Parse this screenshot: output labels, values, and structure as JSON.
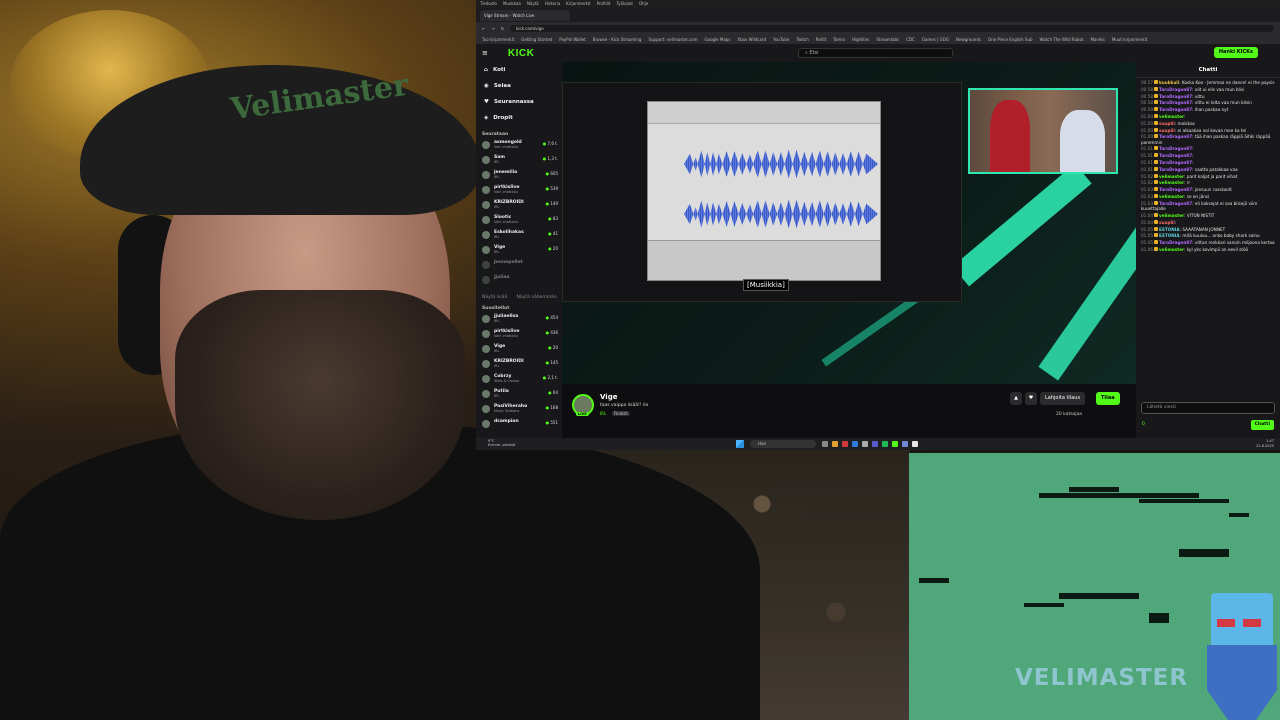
{
  "os_menu": [
    "Tiedosto",
    "Muokkaa",
    "Näytä",
    "Historia",
    "Kirjanmerkit",
    "Profiilit",
    "Työkalut",
    "Ohje"
  ],
  "browser": {
    "tab_title": "Vige Stream - Watch Live",
    "url": "kick.com/vige",
    "bookmarks": [
      "Tuo kirjanmerkit",
      "Getting Started",
      "PayPal Wallet",
      "Browse - Kick Streaming",
      "Support: velimaster.com",
      "Google Maps",
      "Xbox Wildcard",
      "YouTube",
      "Twitch",
      "Reitit",
      "Tomio",
      "Highlites",
      "Streamlabs",
      "CDC",
      "Games | GOG",
      "Newgrounds",
      "One Piece English Sub",
      "Watch The Wild Robot",
      "Mareks",
      "Muut kirjanmerkit"
    ]
  },
  "kick": {
    "logo": "KICK",
    "search_placeholder": "Etsi",
    "login_label": "Hanki KICKs",
    "nav": {
      "home": "Koti",
      "browse": "Selaa",
      "following": "Seurannassa",
      "drops": "Dropit"
    },
    "section_following": "Seurataan",
    "section_recommended": "Suositellut",
    "following_channels": [
      {
        "name": "asmongold",
        "sub": "Vain chattailu",
        "count": "7,6 t."
      },
      {
        "name": "Sam",
        "sub": "IRL",
        "count": "1,3 t."
      },
      {
        "name": "jenemilia",
        "sub": "IRL",
        "count": "605"
      },
      {
        "name": "pirtkislive",
        "sub": "Vain chattailu",
        "count": "539"
      },
      {
        "name": "KRIZBROIDI",
        "sub": "IRL",
        "count": "149"
      },
      {
        "name": "Slootic",
        "sub": "Vain chattailu",
        "count": "83"
      },
      {
        "name": "Eskolihakas",
        "sub": "IRL",
        "count": "41"
      },
      {
        "name": "Vige",
        "sub": "IRL",
        "count": "20"
      },
      {
        "name": "Jonnepellet",
        "sub": "",
        "count": ""
      },
      {
        "name": "jjuliaa",
        "sub": "",
        "count": ""
      }
    ],
    "show_more": "Näytä lisää",
    "show_less": "Näytä vähemmän",
    "recommended_channels": [
      {
        "name": "jjuliaelisa",
        "sub": "IRL",
        "count": "454"
      },
      {
        "name": "pirtkislive",
        "sub": "Vain chattailu",
        "count": "436"
      },
      {
        "name": "Vige",
        "sub": "IRL",
        "count": "20"
      },
      {
        "name": "KRIZBROIDI",
        "sub": "IRL",
        "count": "145"
      },
      {
        "name": "Cobrzy",
        "sub": "Slots & Casino",
        "count": "2,1 t."
      },
      {
        "name": "Putila",
        "sub": "IRL",
        "count": "64"
      },
      {
        "name": "PasiViheraho",
        "sub": "Music Stations",
        "count": "168"
      },
      {
        "name": "dcampion",
        "sub": "",
        "count": "551"
      }
    ],
    "subtitle": "[Musiikkia]",
    "streamer_name": "Vige",
    "stream_title": "taas vaippa lisää!! ilo",
    "category": "IRL",
    "tag": "Finnish",
    "gift_label": "Lahjoita tilaus",
    "follow_label": "Tilaa",
    "viewers": "20 katsojaa",
    "live_badge": "LIVE"
  },
  "chat": {
    "title": "Chatti",
    "messages": [
      {
        "time": "00.57",
        "user": "kuukkuli",
        "color": "#f0c040",
        "text": "Koska Koo - Jemmaa ne dance! ei the paysis"
      },
      {
        "time": "00.58",
        "user": "TaroDragon87",
        "color": "#b36bff",
        "text": "olit ui elis vaa mun blisi"
      },
      {
        "time": "00.58",
        "user": "TaroDragon87",
        "color": "#b36bff",
        "text": "vittu"
      },
      {
        "time": "00.58",
        "user": "TaroDragon87",
        "color": "#b36bff",
        "text": "vittu ei lolta vaa mun bilsin"
      },
      {
        "time": "00.59",
        "user": "TaroDragon87",
        "color": "#b36bff",
        "text": "ihan paskaa nyt"
      },
      {
        "time": "01.00",
        "user": "velimaster",
        "color": "#53fc18",
        "text": ""
      },
      {
        "time": "01.00",
        "user": "suuplii",
        "color": "#ff6b6b",
        "text": "moikkas"
      },
      {
        "time": "01.00",
        "user": "suuplii",
        "color": "#ff6b6b",
        "text": "ei alkaakaa noi kovaa mee ka tei"
      },
      {
        "time": "01.00",
        "user": "TaroDragon87",
        "color": "#b36bff",
        "text": "tää ihan paskaa räppiä äitiki räppää paremmin"
      },
      {
        "time": "01.01",
        "user": "TaroDragon87",
        "color": "#b36bff",
        "text": ""
      },
      {
        "time": "01.01",
        "user": "TaroDragon87",
        "color": "#b36bff",
        "text": ""
      },
      {
        "time": "01.01",
        "user": "TaroDragon87",
        "color": "#b36bff",
        "text": ""
      },
      {
        "time": "01.01",
        "user": "TaroDragon87",
        "color": "#b36bff",
        "text": "saatto patakkaa vaa"
      },
      {
        "time": "01.02",
        "user": "velimaster",
        "color": "#53fc18",
        "text": "parit kaljat ja parit vihat"
      },
      {
        "time": "01.02",
        "user": "velimaster",
        "color": "#53fc18",
        "text": "rr"
      },
      {
        "time": "01.03",
        "user": "TaroDragon87",
        "color": "#b36bff",
        "text": "jonsuun russkanit"
      },
      {
        "time": "01.03",
        "user": "velimaster",
        "color": "#53fc18",
        "text": "se on jänsi"
      },
      {
        "time": "01.03",
        "user": "TaroDragon87",
        "color": "#b36bff",
        "text": "eli kaksejat ei saa biisejä viim kuuettajalle"
      },
      {
        "time": "01.04",
        "user": "velimaster",
        "color": "#53fc18",
        "text": "VITUN NISTIT"
      },
      {
        "time": "01.04",
        "user": "suuplii",
        "color": "#ff6b6b",
        "text": ""
      },
      {
        "time": "01.05",
        "user": "ESTONIA",
        "color": "#5fd0e0",
        "text": "SAAATANAN JONNET"
      },
      {
        "time": "01.05",
        "user": "ESTONIA",
        "color": "#5fd0e0",
        "text": "mitä kuuluu... onko baby shark soinu"
      },
      {
        "time": "01.05",
        "user": "TaroDragon87",
        "color": "#b36bff",
        "text": "vittun ronkkari sanoin miljoona kertaa"
      },
      {
        "time": "01.06",
        "user": "velimaster",
        "color": "#53fc18",
        "text": "kyl yks kovimpii on eevil stöö"
      }
    ],
    "input_placeholder": "Lähetä viesti",
    "send_label": "Chatti",
    "points": "0"
  },
  "taskbar": {
    "weather_temp": "9°C",
    "weather_desc": "Enimm. pilvistä",
    "search_label": "Hae",
    "time": "1.47",
    "date": "22.8.2025"
  },
  "game": {
    "logo": "VELIMASTER"
  },
  "colors": {
    "kick_green": "#53fc18",
    "game_bg": "#50a779",
    "accent_teal": "#2fe5b0"
  }
}
